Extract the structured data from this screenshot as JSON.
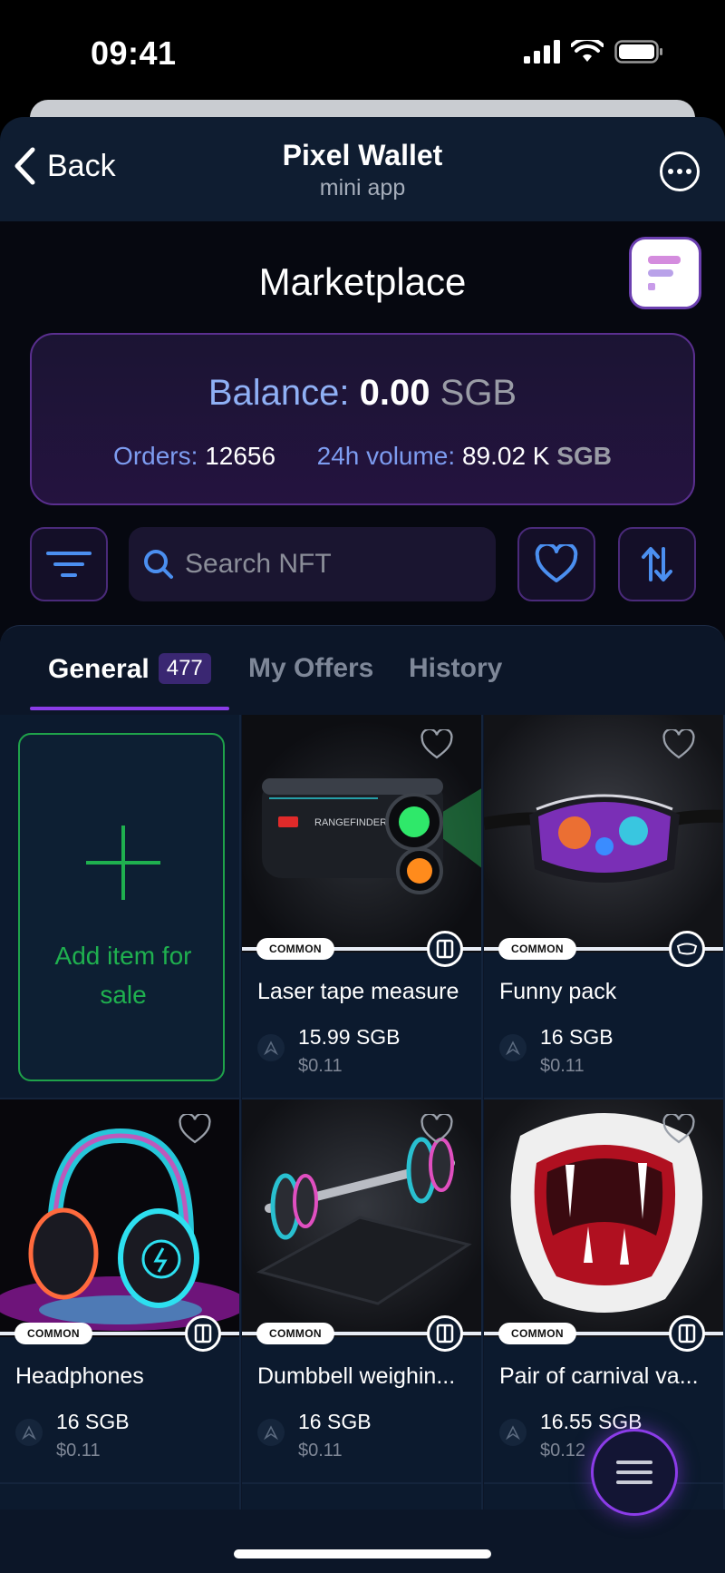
{
  "status_bar": {
    "time": "09:41"
  },
  "header": {
    "back_label": "Back",
    "title": "Pixel Wallet",
    "subtitle": "mini app"
  },
  "page": {
    "title": "Marketplace"
  },
  "balance": {
    "label": "Balance:",
    "value": "0.00",
    "currency": "SGB",
    "orders_label": "Orders:",
    "orders_value": "12656",
    "volume_label": "24h volume:",
    "volume_value": "89.02 K",
    "volume_currency": "SGB"
  },
  "search": {
    "placeholder": "Search NFT"
  },
  "tabs": [
    {
      "label": "General",
      "count": "477",
      "active": true
    },
    {
      "label": "My Offers"
    },
    {
      "label": "History"
    }
  ],
  "add_item": {
    "label": "Add item for sale"
  },
  "items": [
    {
      "name": "Laser tape measure",
      "rarity": "COMMON",
      "price": "15.99 SGB",
      "usd": "$0.11",
      "icon": "tower-icon"
    },
    {
      "name": "Funny pack",
      "rarity": "COMMON",
      "price": "16 SGB",
      "usd": "$0.11",
      "icon": "waist-bag-icon"
    },
    {
      "name": "Headphones",
      "rarity": "COMMON",
      "price": "16 SGB",
      "usd": "$0.11",
      "icon": "tower-icon"
    },
    {
      "name": "Dumbbell weighin...",
      "rarity": "COMMON",
      "price": "16 SGB",
      "usd": "$0.11",
      "icon": "tower-icon"
    },
    {
      "name": "Pair of carnival va...",
      "rarity": "COMMON",
      "price": "16.55 SGB",
      "usd": "$0.12",
      "icon": "tower-icon"
    }
  ],
  "colors": {
    "accent_purple": "#8b3ce8",
    "add_green": "#1fb04f",
    "balance_label_blue": "#8fb0f5",
    "panel_bg": "#0c1628"
  }
}
